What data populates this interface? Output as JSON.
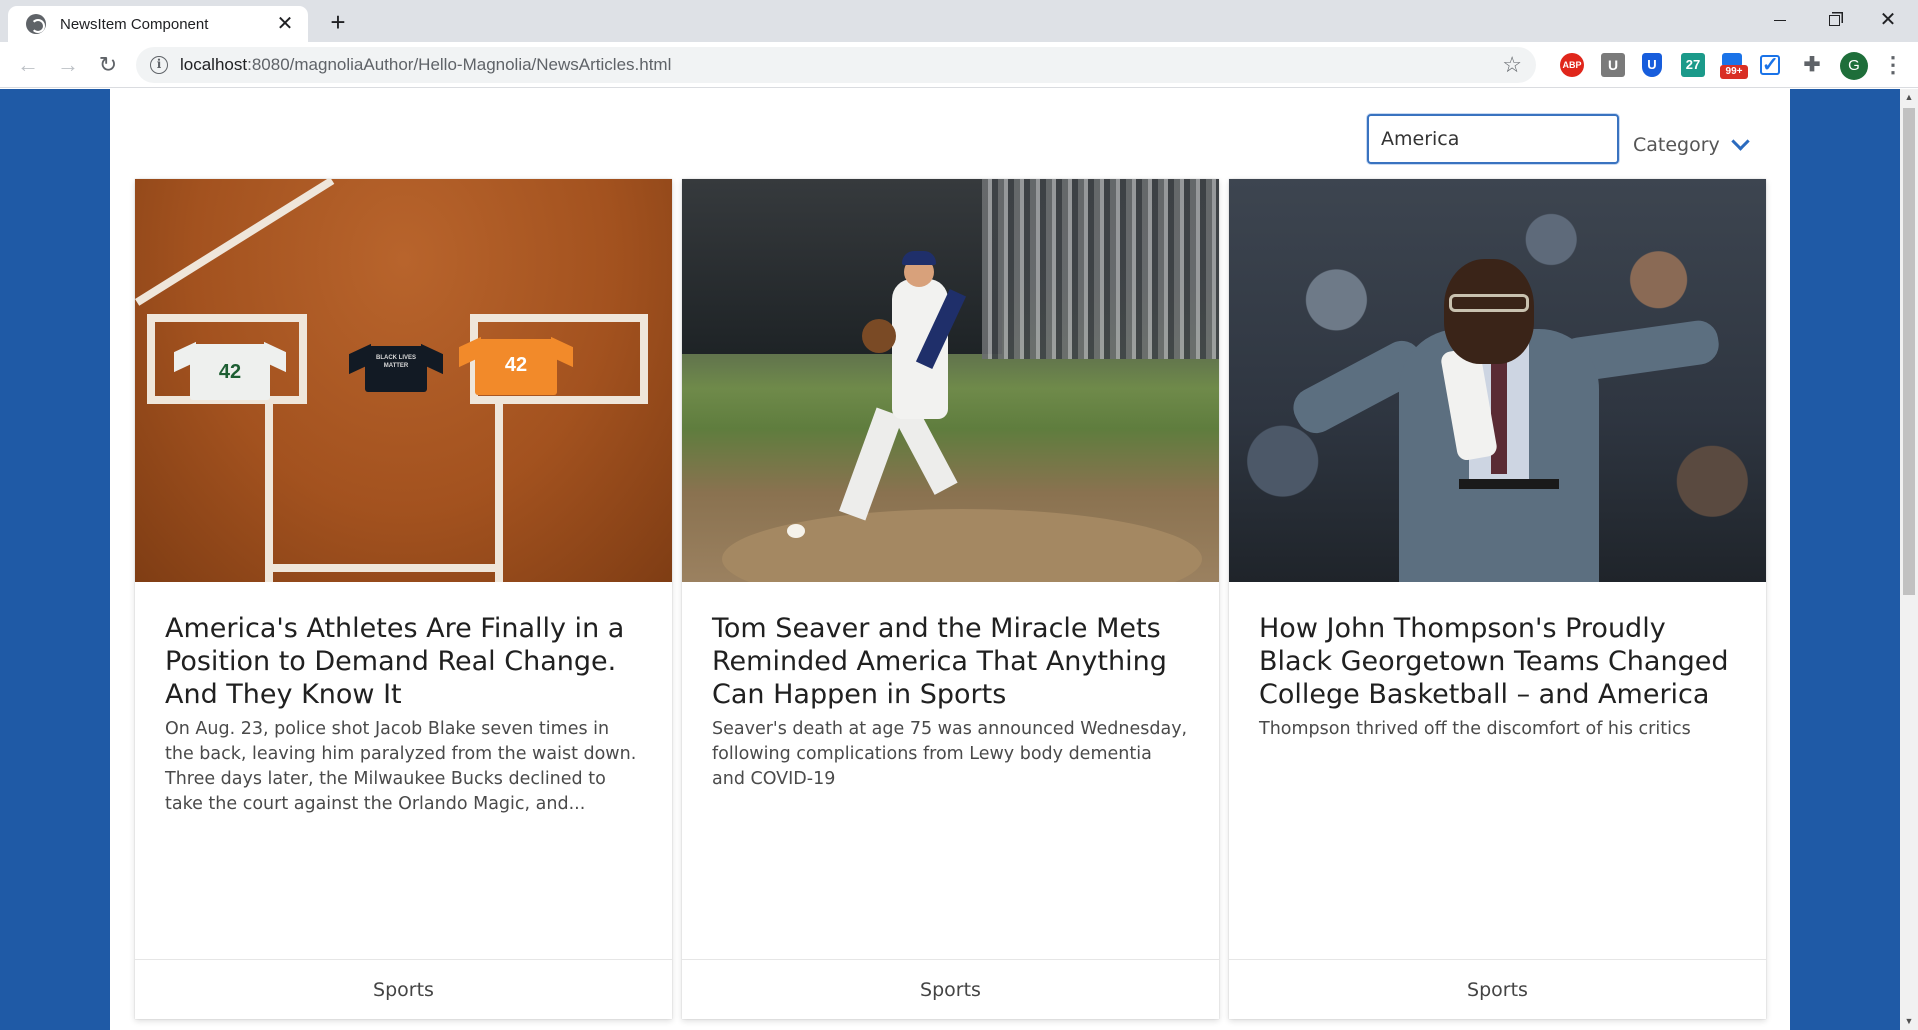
{
  "browser": {
    "tab_title": "NewsItem Component",
    "tab_close": "✕",
    "new_tab": "+",
    "url_host": "localhost",
    "url_rest": ":8080/magnoliaAuthor/Hello-Magnolia/NewsArticles.html",
    "extensions": {
      "abp": "ABP",
      "u": "U",
      "bitwarden": "U",
      "calendar": "27",
      "badge": "99+",
      "profile": "G"
    }
  },
  "page": {
    "search": {
      "value": "America"
    },
    "category_label": "Category"
  },
  "articles": [
    {
      "title": "America's Athletes Are Finally in a Position to Demand Real Change. And They Know It",
      "summary": "On Aug. 23, police shot Jacob Blake seven times in the back, leaving him paralyzed from the waist down. Three days later, the Milwaukee Bucks declined to take the court against the Orlando Magic, and...",
      "category": "Sports",
      "image": {
        "jersey_left": "42",
        "jersey_middle": "BLACK LIVES MATTER",
        "jersey_right": "42"
      }
    },
    {
      "title": "Tom Seaver and the Miracle Mets Reminded America That Anything Can Happen in Sports",
      "summary": "Seaver's death at age 75 was announced Wednesday, following complications from Lewy body dementia and COVID-19",
      "category": "Sports"
    },
    {
      "title": "How John Thompson's Proudly Black Georgetown Teams Changed College Basketball – and America",
      "summary": "Thompson thrived off the discomfort of his critics",
      "category": "Sports"
    }
  ]
}
